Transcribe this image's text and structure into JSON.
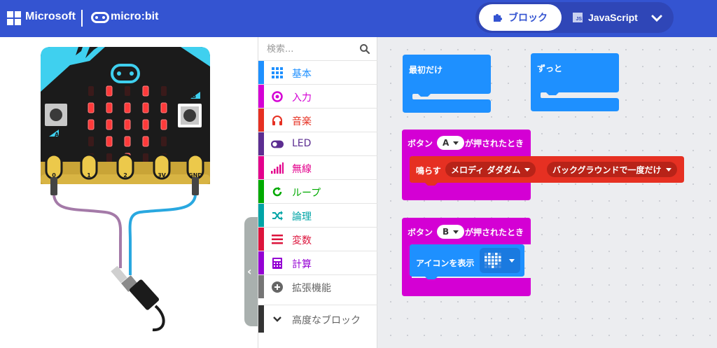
{
  "header": {
    "brand": "Microsoft",
    "product": "micro:bit",
    "tabs": [
      {
        "label": "ブロック",
        "icon": "puzzle-icon",
        "active": true
      },
      {
        "label": "JavaScript",
        "icon": "js-icon",
        "active": false
      }
    ],
    "js_badge": "JS",
    "colors": {
      "header": "#3454d1",
      "toggle": "#2f46b7"
    }
  },
  "simulator": {
    "pin_labels": [
      "0",
      "1",
      "2",
      "3V",
      "GND"
    ],
    "button_labels": [
      "A",
      "B"
    ],
    "led_pattern": [
      [
        0,
        1,
        0,
        1,
        0
      ],
      [
        1,
        1,
        1,
        1,
        1
      ],
      [
        1,
        1,
        1,
        1,
        1
      ],
      [
        0,
        1,
        1,
        1,
        0
      ],
      [
        0,
        0,
        1,
        0,
        0
      ]
    ]
  },
  "toolbox": {
    "search_placeholder": "検索...",
    "categories": [
      {
        "label": "基本",
        "color": "#1e90ff",
        "icon": "grid-icon"
      },
      {
        "label": "入力",
        "color": "#d400d4",
        "icon": "circle-dot-icon"
      },
      {
        "label": "音楽",
        "color": "#e63022",
        "icon": "headphones-icon"
      },
      {
        "label": "LED",
        "color": "#5c2d91",
        "icon": "toggle-icon"
      },
      {
        "label": "無線",
        "color": "#e3008c",
        "icon": "signal-bars-icon"
      },
      {
        "label": "ループ",
        "color": "#00aa00",
        "icon": "refresh-icon"
      },
      {
        "label": "論理",
        "color": "#00a4a6",
        "icon": "shuffle-icon"
      },
      {
        "label": "変数",
        "color": "#dc143c",
        "icon": "list-lines-icon"
      },
      {
        "label": "計算",
        "color": "#9400d3",
        "icon": "calculator-icon"
      },
      {
        "label": "拡張機能",
        "color": "#757575",
        "icon": "plus-circle-icon"
      }
    ],
    "advanced": {
      "label": "高度なブロック",
      "icon": "chevron-down-icon"
    }
  },
  "workspace": {
    "on_start": "最初だけ",
    "forever": "ずっと",
    "button_a_event": {
      "prefix": "ボタン",
      "button": "A",
      "suffix": "が押されたとき"
    },
    "play_melody": {
      "label": "鳴らす",
      "melody": "メロディ ダダダム",
      "mode": "バックグラウンドで一度だけ"
    },
    "button_b_event": {
      "prefix": "ボタン",
      "button": "B",
      "suffix": "が押されたとき"
    },
    "show_icon": {
      "label": "アイコンを表示"
    },
    "colors": {
      "basic": "#1e90ff",
      "input": "#d400d4",
      "music": "#e63022"
    }
  }
}
